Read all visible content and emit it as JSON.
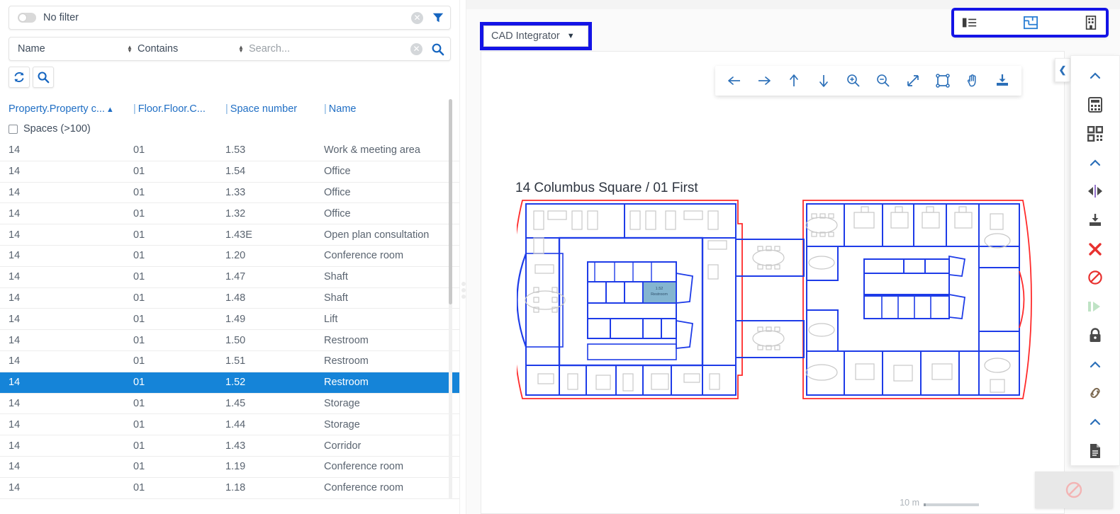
{
  "left_panel": {
    "filter": {
      "toggle_state": "off",
      "label": "No filter",
      "clear_icon": "clear-circle-icon",
      "funnel_icon": "funnel-icon"
    },
    "search": {
      "field": "Name",
      "operator": "Contains",
      "placeholder": "Search...",
      "value": "",
      "clear_icon": "clear-circle-icon",
      "search_icon": "magnifier-icon"
    },
    "action_buttons": [
      {
        "name": "refresh-button",
        "icon": "refresh-icon"
      },
      {
        "name": "search-button",
        "icon": "magnifier-icon"
      }
    ],
    "grid": {
      "columns": [
        {
          "label": "Property.Property c...",
          "sorted": "asc"
        },
        {
          "label": "Floor.Floor.C..."
        },
        {
          "label": "Space number"
        },
        {
          "label": "Name"
        }
      ],
      "group_row": {
        "label": "Spaces (>100)",
        "checked": false
      },
      "rows": [
        {
          "property": "14",
          "floor": "01",
          "space": "1.53",
          "name": "Work & meeting area",
          "selected": false
        },
        {
          "property": "14",
          "floor": "01",
          "space": "1.54",
          "name": "Office",
          "selected": false
        },
        {
          "property": "14",
          "floor": "01",
          "space": "1.33",
          "name": "Office",
          "selected": false
        },
        {
          "property": "14",
          "floor": "01",
          "space": "1.32",
          "name": "Office",
          "selected": false
        },
        {
          "property": "14",
          "floor": "01",
          "space": "1.43E",
          "name": "Open plan consultation",
          "selected": false
        },
        {
          "property": "14",
          "floor": "01",
          "space": "1.20",
          "name": "Conference room",
          "selected": false
        },
        {
          "property": "14",
          "floor": "01",
          "space": "1.47",
          "name": "Shaft",
          "selected": false
        },
        {
          "property": "14",
          "floor": "01",
          "space": "1.48",
          "name": "Shaft",
          "selected": false
        },
        {
          "property": "14",
          "floor": "01",
          "space": "1.49",
          "name": "Lift",
          "selected": false
        },
        {
          "property": "14",
          "floor": "01",
          "space": "1.50",
          "name": "Restroom",
          "selected": false
        },
        {
          "property": "14",
          "floor": "01",
          "space": "1.51",
          "name": "Restroom",
          "selected": false
        },
        {
          "property": "14",
          "floor": "01",
          "space": "1.52",
          "name": "Restroom",
          "selected": true
        },
        {
          "property": "14",
          "floor": "01",
          "space": "1.45",
          "name": "Storage",
          "selected": false
        },
        {
          "property": "14",
          "floor": "01",
          "space": "1.44",
          "name": "Storage",
          "selected": false
        },
        {
          "property": "14",
          "floor": "01",
          "space": "1.43",
          "name": "Corridor",
          "selected": false
        },
        {
          "property": "14",
          "floor": "01",
          "space": "1.19",
          "name": "Conference room",
          "selected": false
        },
        {
          "property": "14",
          "floor": "01",
          "space": "1.18",
          "name": "Conference room",
          "selected": false
        }
      ]
    }
  },
  "main": {
    "module_dropdown": {
      "label": "CAD Integrator",
      "caret": "chevron-down-icon",
      "highlighted": true
    },
    "view_toolbar": {
      "highlighted": true,
      "items": [
        {
          "name": "list-view-icon",
          "active": false
        },
        {
          "name": "floorplan-view-icon",
          "active": true
        },
        {
          "name": "building-view-icon",
          "active": false
        }
      ]
    },
    "float_tools": [
      {
        "name": "pan-left-icon",
        "glyph": "arrow-left"
      },
      {
        "name": "pan-right-icon",
        "glyph": "arrow-right"
      },
      {
        "name": "pan-up-icon",
        "glyph": "arrow-up"
      },
      {
        "name": "pan-down-icon",
        "glyph": "arrow-down"
      },
      {
        "name": "zoom-in-icon",
        "glyph": "magnifier-plus"
      },
      {
        "name": "zoom-out-icon",
        "glyph": "magnifier-minus"
      },
      {
        "name": "zoom-fit-icon",
        "glyph": "diagonal-arrows"
      },
      {
        "name": "zoom-window-icon",
        "glyph": "selection-box"
      },
      {
        "name": "pan-hand-icon",
        "glyph": "hand"
      },
      {
        "name": "download-drawing-icon",
        "glyph": "download-tray"
      }
    ],
    "plan": {
      "title": "14 Columbus Square / 01 First",
      "selected_space_label_number": "1.52",
      "selected_space_label_name": "Restroom",
      "scale_label": "10 m",
      "colors": {
        "outline": "#ff2a2a",
        "walls": "#1e3ce8",
        "furniture": "#c8c8c8",
        "selection": "#6fa8c8"
      }
    }
  },
  "right_sidebar": {
    "collapse_icon": "chevron-left-icon",
    "items": [
      {
        "name": "group-collapse-1-icon",
        "glyph": "chevron-up",
        "color": "#2b6fb8"
      },
      {
        "name": "calculator-icon",
        "glyph": "calculator",
        "color": "#4a4a4a"
      },
      {
        "name": "qr-code-icon",
        "glyph": "qr",
        "color": "#4a4a4a"
      },
      {
        "name": "group-collapse-2-icon",
        "glyph": "chevron-up",
        "color": "#2b6fb8"
      },
      {
        "name": "mirror-flip-icon",
        "glyph": "mirror",
        "color": "#4a4a4a"
      },
      {
        "name": "download-icon",
        "glyph": "download-tray",
        "color": "#4a4a4a"
      },
      {
        "name": "delete-x-icon",
        "glyph": "x-mark",
        "color": "#e8312f"
      },
      {
        "name": "block-icon",
        "glyph": "prohibition",
        "color": "#e8312f"
      },
      {
        "name": "play-next-icon",
        "glyph": "play",
        "color": "#bfe3c5"
      },
      {
        "name": "lock-icon",
        "glyph": "lock",
        "color": "#4a4a4a"
      },
      {
        "name": "group-collapse-3-icon",
        "glyph": "chevron-up",
        "color": "#2b6fb8"
      },
      {
        "name": "link-icon",
        "glyph": "chain",
        "color": "#7d6a52"
      },
      {
        "name": "group-collapse-4-icon",
        "glyph": "chevron-up",
        "color": "#2b6fb8"
      },
      {
        "name": "document-icon",
        "glyph": "document",
        "color": "#4a4a4a"
      }
    ],
    "bottom_disabled": {
      "name": "disabled-block-icon",
      "glyph": "prohibition"
    }
  }
}
